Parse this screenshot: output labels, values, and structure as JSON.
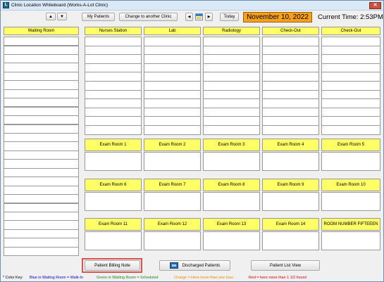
{
  "window": {
    "title": "Clinic Location Whiteboard (Works-A-Lot Clinic)",
    "app_icon": "L",
    "close_glyph": "✕"
  },
  "toolbar": {
    "up_glyph": "▲",
    "down_glyph": "▼",
    "my_patients": "My Patients",
    "my_patients_mnemonic": "M",
    "change_clinic": "Change to another Clinic",
    "prev_glyph": "◀",
    "next_glyph": "▶",
    "today": "Today",
    "date": "November 10, 2022",
    "current_time": "Current Time: 2:53PM"
  },
  "columns": [
    {
      "label": "Waiting Room"
    },
    {
      "label": "Nurses Station"
    },
    {
      "label": "Lab"
    },
    {
      "label": "Radiology"
    },
    {
      "label": "Check-Out"
    },
    {
      "label": "Check-Out"
    }
  ],
  "exam_rooms": [
    [
      "Exam Room 1",
      "Exam Room 2",
      "Exam Room 3",
      "Exam Room 4",
      "Exam Room 5"
    ],
    [
      "Exam Room 6",
      "Exam Room 7",
      "Exam Room 8",
      "Exam Room 9",
      "Exam Room 10"
    ],
    [
      "Exam Room 11",
      "Exam Room 12",
      "Exam Room 13",
      "Exam Room 14",
      "ROOM NUMBER FIFTEEEN"
    ]
  ],
  "bottom": {
    "patient_billing_note": "Patient Billing Note",
    "discharged_patients": "Discharged Patients",
    "patient_list_view": "Patient List View"
  },
  "legend": {
    "label": "* Color Key:",
    "blue": "Blue in Waiting Room = Walk-In",
    "green": "Green in Waiting Room = Scheduled",
    "orange": "Orange = Here more than one hour",
    "red": "Red = here more than 1 1/2 hours!",
    "colors": {
      "blue": "#0000cc",
      "green": "#1a8a1a",
      "orange": "#f08a00",
      "red": "#e00000"
    }
  },
  "colors": {
    "header_yellow": "#ffff66",
    "date_orange": "#f7a11a",
    "highlight_red": "#d9534f"
  }
}
